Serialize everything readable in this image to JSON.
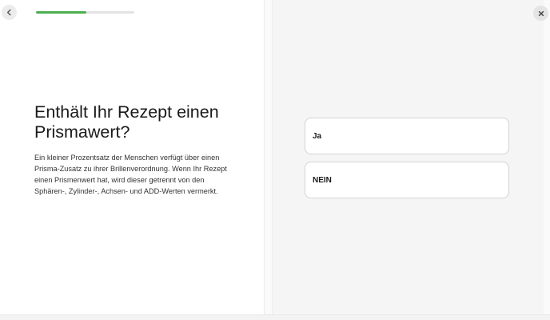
{
  "navigation": {
    "back_icon": "chevron-left-icon",
    "close_icon": "close-icon"
  },
  "progress": {
    "fraction": 0.51
  },
  "question": {
    "title": "Enthält Ihr Rezept einen Prismawert?",
    "description": "Ein kleiner Prozentsatz der Menschen verfügt über einen Prisma-Zusatz zu ihrer Brillenverordnung. Wenn Ihr Rezept einen Prismenwert hat, wird dieser getrennt von den Sphären-, Zylinder-, Achsen- und ADD-Werten vermerkt."
  },
  "options": [
    {
      "label": "Ja"
    },
    {
      "label": "NEIN"
    }
  ],
  "colors": {
    "progress_fill": "#4caf50",
    "progress_track": "#e3e3e3",
    "right_panel_bg": "#f5f5f5",
    "option_border": "#d4d4d4",
    "text": "#1a1a1a"
  }
}
